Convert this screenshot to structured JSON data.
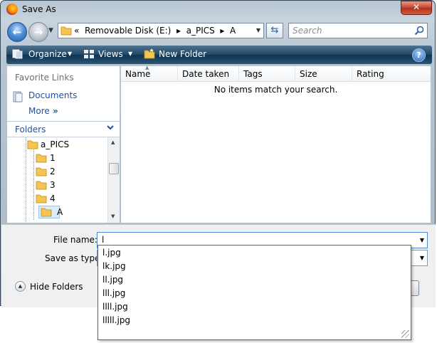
{
  "window": {
    "title": "Save As",
    "close_glyph": "✕"
  },
  "address_bar": {
    "path_text": "«  Removable Disk (E:)  ▸  a_PICS  ▸  A",
    "refresh_icon": "refresh-icon"
  },
  "search": {
    "placeholder": "Search"
  },
  "toolbar": {
    "organize_label": "Organize",
    "views_label": "Views",
    "new_folder_label": "New Folder",
    "help_glyph": "?"
  },
  "navigation": {
    "favorite_links_label": "Favorite Links",
    "documents_label": "Documents",
    "more_label": "More",
    "more_chevrons": "»",
    "folders_label": "Folders",
    "tree_items": [
      {
        "label": "a_PICS"
      },
      {
        "label": "1"
      },
      {
        "label": "2"
      },
      {
        "label": "3"
      },
      {
        "label": "4"
      },
      {
        "label": "A"
      }
    ]
  },
  "file_list": {
    "columns": [
      "Name",
      "Date taken",
      "Tags",
      "Size",
      "Rating"
    ],
    "empty_message": "No items match your search."
  },
  "form": {
    "file_name_label": "File name:",
    "file_name_value": "l",
    "save_as_type_label": "Save as type:",
    "save_as_type_value": ""
  },
  "autocomplete": {
    "items": [
      "l.jpg",
      "lk.jpg",
      "ll.jpg",
      "lll.jpg",
      "llll.jpg",
      "lllll.jpg"
    ]
  },
  "footer": {
    "hide_folders_label": "Hide Folders"
  },
  "colors": {
    "toolbar": "#1f4763",
    "link": "#1c52a3",
    "selection": "#dcecfb",
    "close": "#c2452f"
  }
}
